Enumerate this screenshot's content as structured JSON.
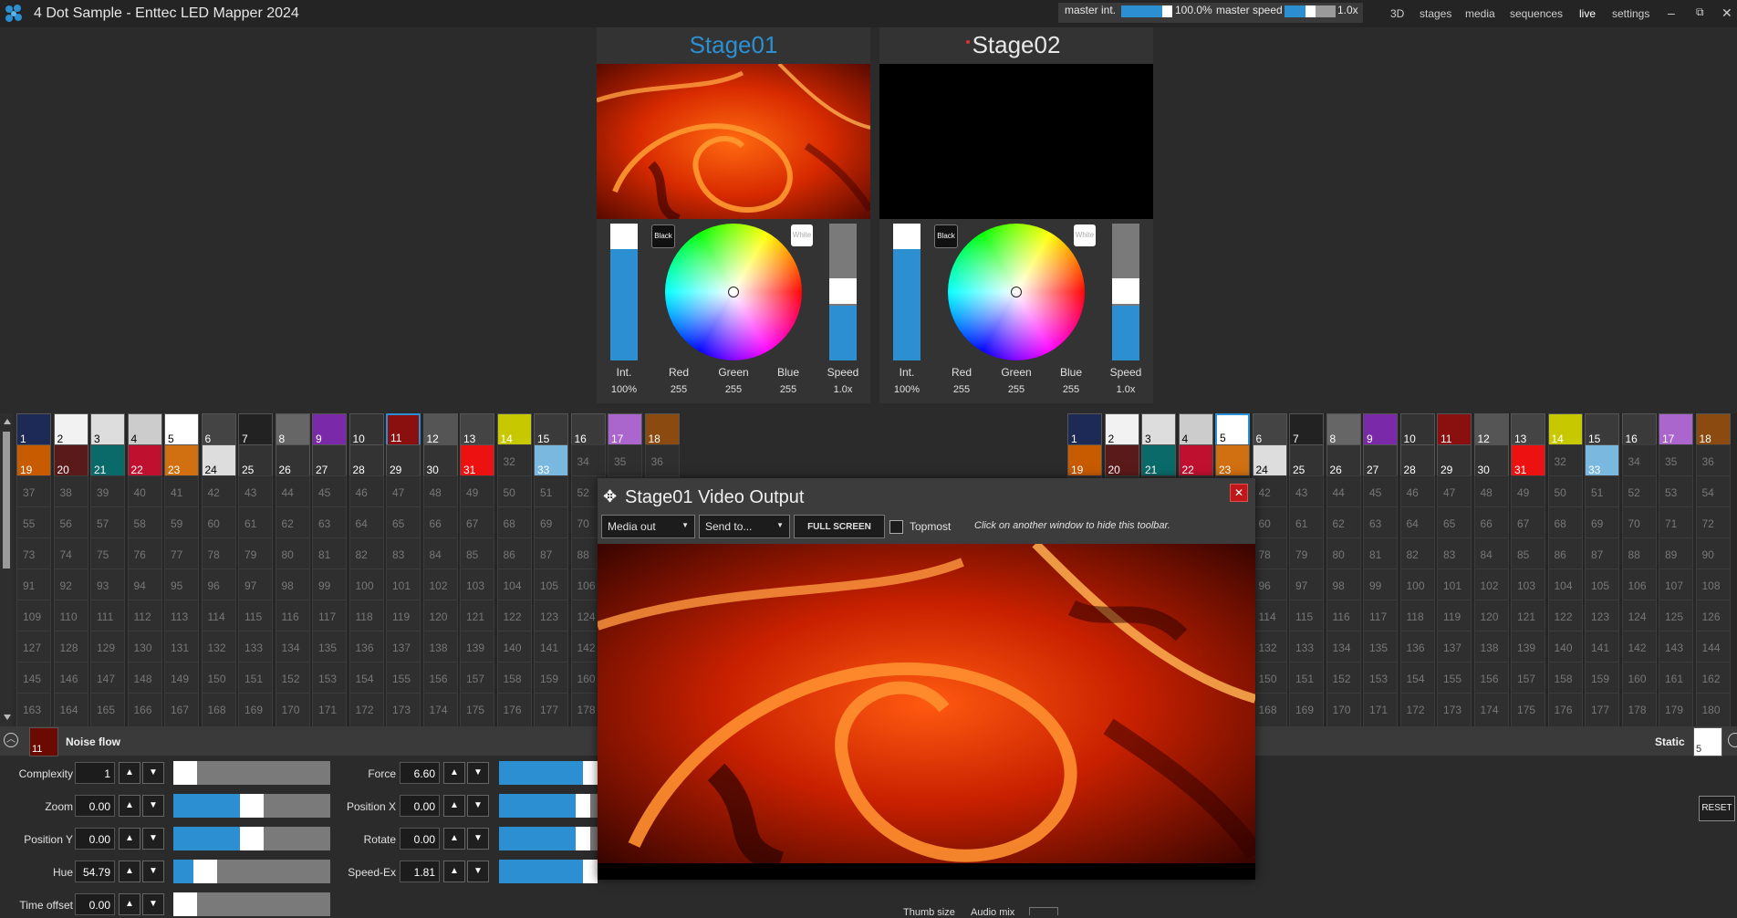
{
  "window": {
    "title": "4 Dot Sample - Enttec LED Mapper 2024"
  },
  "master": {
    "int_label": "master int.",
    "int_value": "100.0%",
    "int_level": 1.0,
    "speed_label": "master speed",
    "speed_value": "1.0x",
    "speed_level": 0.5
  },
  "nav": {
    "items": [
      "3D",
      "stages",
      "media",
      "sequences",
      "live",
      "settings"
    ],
    "active": "live"
  },
  "window_controls": {
    "minimize": "–",
    "restore": "⧉",
    "close": "✕"
  },
  "stages": [
    {
      "title": "Stage01",
      "active": true,
      "title_color": "#2b8fd1",
      "black": "Black",
      "white": "White",
      "controls": [
        {
          "label": "Int.",
          "value": "100%"
        },
        {
          "label": "Red",
          "value": "255"
        },
        {
          "label": "Green",
          "value": "255"
        },
        {
          "label": "Blue",
          "value": "255"
        },
        {
          "label": "Speed",
          "value": "1.0x"
        }
      ]
    },
    {
      "title": "Stage02",
      "active": false,
      "title_color": "#e8e8e8",
      "black": "Black",
      "white": "White",
      "controls": [
        {
          "label": "Int.",
          "value": "100%"
        },
        {
          "label": "Red",
          "value": "255"
        },
        {
          "label": "Green",
          "value": "255"
        },
        {
          "label": "Blue",
          "value": "255"
        },
        {
          "label": "Speed",
          "value": "1.0x"
        }
      ]
    }
  ],
  "effect": {
    "name": "Noise flow",
    "thumb_num": "11",
    "right_name": "Static",
    "right_num": "5",
    "reset": "RESET"
  },
  "params_left": [
    {
      "label": "Complexity",
      "value": "1",
      "level": 0.0
    },
    {
      "label": "Zoom",
      "value": "0.00",
      "level": 0.5
    },
    {
      "label": "Position Y",
      "value": "0.00",
      "level": 0.5
    },
    {
      "label": "Hue",
      "value": "54.79",
      "level": 0.15
    },
    {
      "label": "Time offset",
      "value": "0.00",
      "level": 0.0
    }
  ],
  "params_mid": [
    {
      "label": "Force",
      "value": "6.60",
      "level": 0.66
    },
    {
      "label": "Position X",
      "value": "0.00",
      "level": 0.5
    },
    {
      "label": "Rotate",
      "value": "0.00",
      "level": 0.5
    },
    {
      "label": "Speed-Ex",
      "value": "1.81",
      "level": 0.6
    }
  ],
  "bottom_labels": {
    "thumb_size": "Thumb size",
    "audio_mix": "Audio mix"
  },
  "video_window": {
    "title": "Stage01 Video Output",
    "media_out": "Media out",
    "send_to": "Send to...",
    "full_screen": "FULL SCREEN",
    "topmost": "Topmost",
    "hint": "Click on another window to hide this toolbar."
  }
}
